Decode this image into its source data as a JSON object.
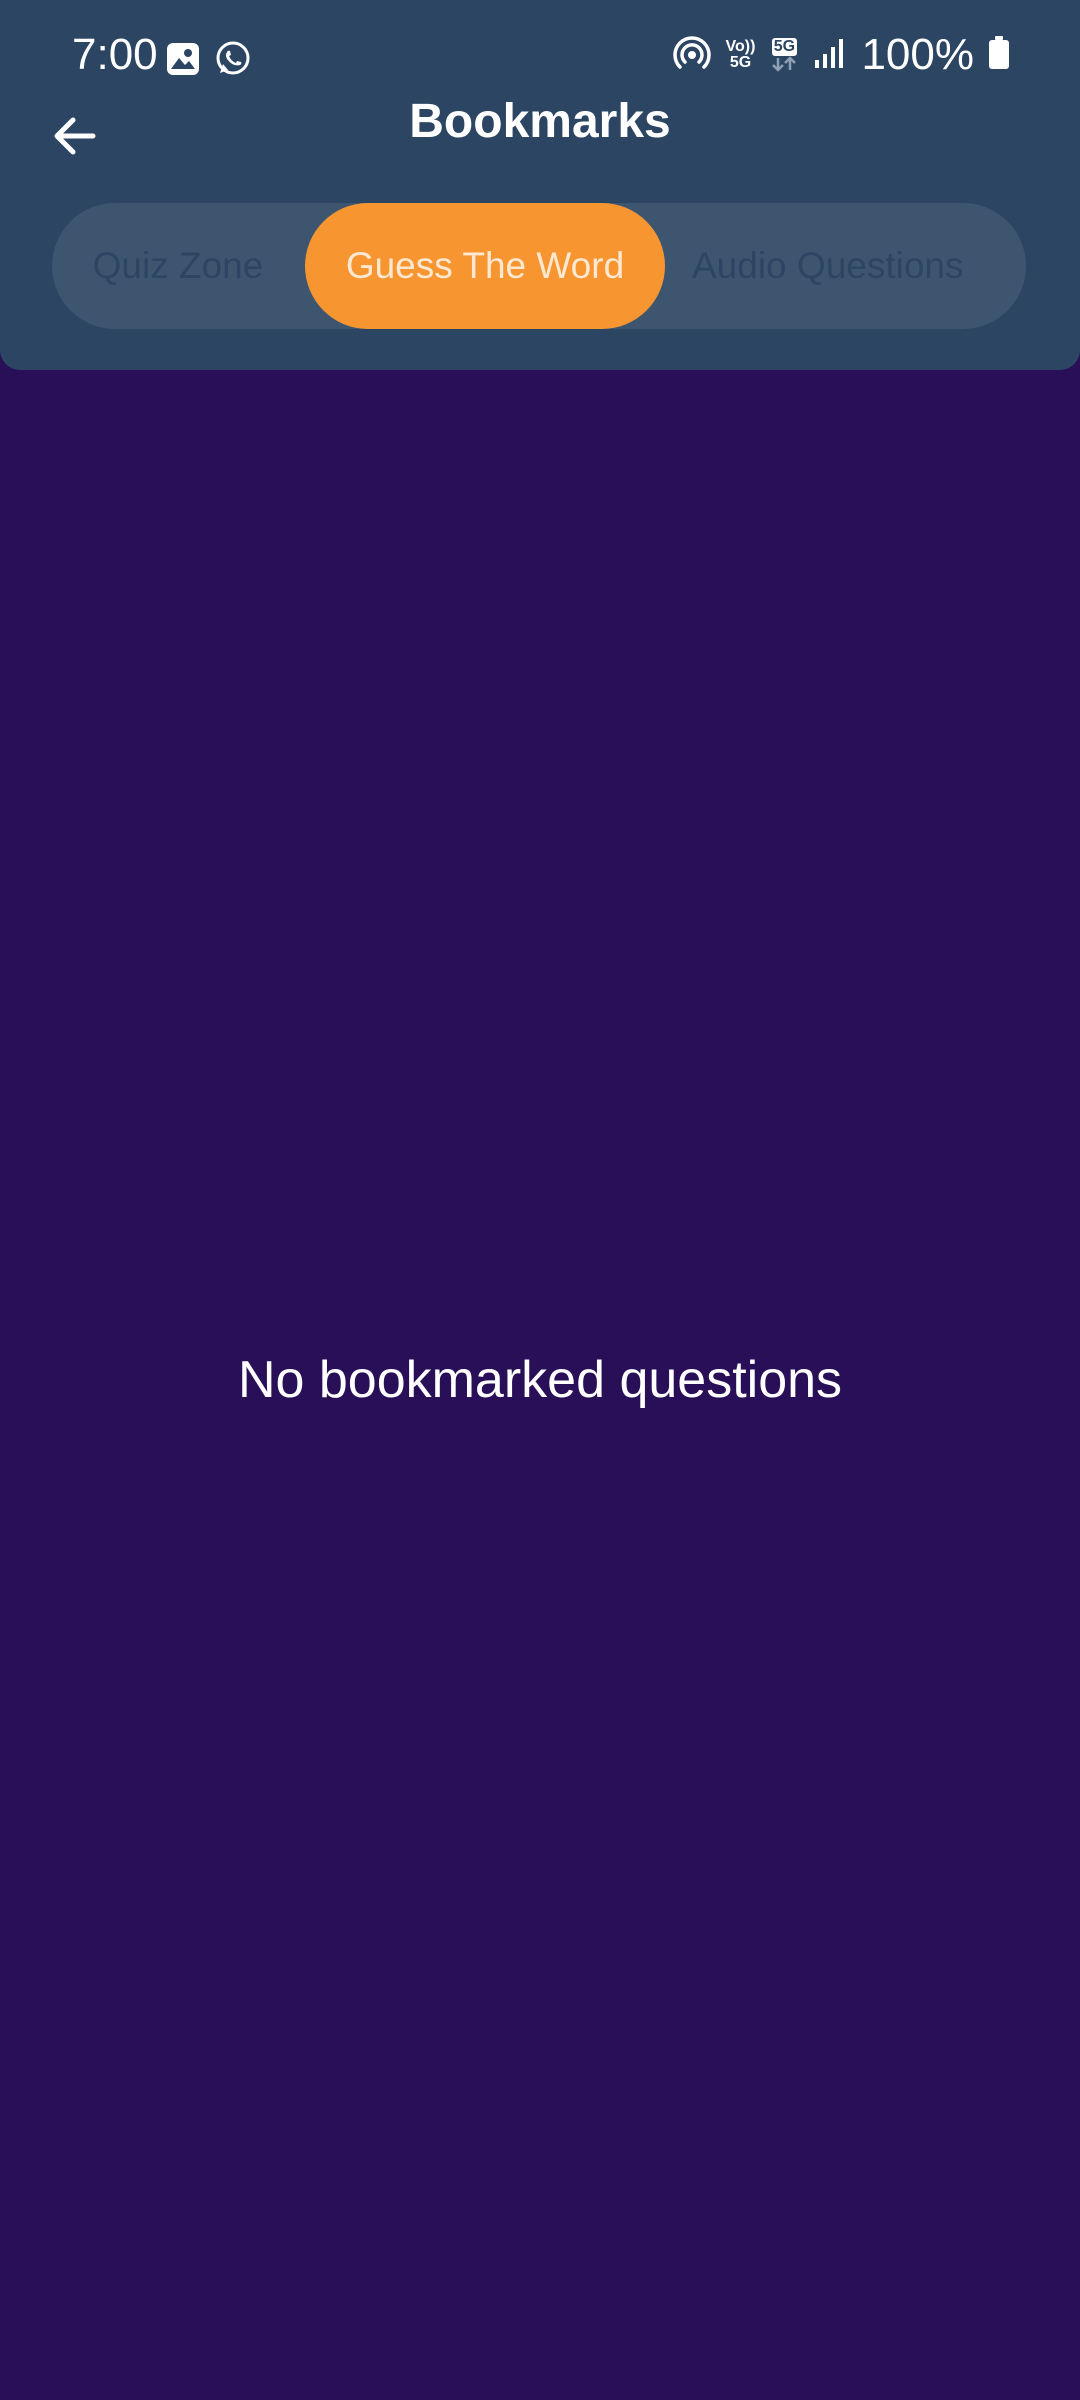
{
  "status_bar": {
    "time": "7:00",
    "left_icons": [
      "image-icon",
      "whatsapp-icon"
    ],
    "right_icons": [
      "hotspot-icon",
      "volte-5g-icon",
      "5g-data-icon",
      "signal-icon",
      "battery-icon"
    ],
    "volte_top": "Vo))",
    "volte_bottom": "5G",
    "data_label": "5G",
    "battery": "100%"
  },
  "header": {
    "title": "Bookmarks",
    "back_icon": "arrow-left-icon"
  },
  "tabs": [
    {
      "label": "Quiz Zone",
      "active": false
    },
    {
      "label": "Guess The Word",
      "active": true
    },
    {
      "label": "Audio Questions",
      "active": false
    }
  ],
  "content": {
    "empty_message": "No bookmarked questions"
  },
  "colors": {
    "background": "#290f58",
    "header": "#2c4562",
    "tab_track": "#3e5570",
    "accent": "#f79530"
  }
}
